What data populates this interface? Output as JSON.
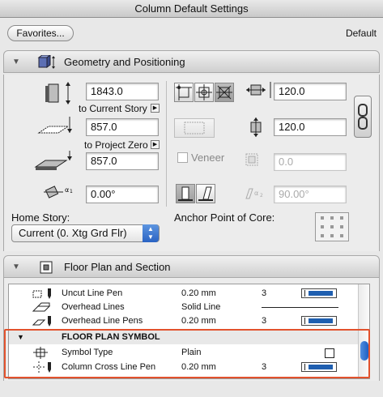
{
  "window": {
    "title": "Column Default Settings"
  },
  "toolbar": {
    "favorites_label": "Favorites...",
    "default_label": "Default"
  },
  "geometry": {
    "title": "Geometry and Positioning",
    "height_value": "1843.0",
    "to_current_story_label": "to Current Story",
    "offset_value": "857.0",
    "to_project_zero_label": "to Project Zero",
    "bottom_value": "857.0",
    "angle_value": "0.00°",
    "width_value": "120.0",
    "depth_value": "120.0",
    "veneer_label": "Veneer",
    "veneer_value": "0.0",
    "slant_value": "90.00°",
    "home_story_label": "Home Story:",
    "home_story_value": "Current (0. Xtg Grd Flr)",
    "anchor_label": "Anchor Point of Core:"
  },
  "floorplan": {
    "title": "Floor Plan and Section",
    "rows": [
      {
        "name": "Uncut Line Pen",
        "value": "0.20 mm",
        "num": "3",
        "widget": "pen"
      },
      {
        "name": "Overhead Lines",
        "value": "Solid Line",
        "num": "",
        "widget": "line"
      },
      {
        "name": "Overhead Line Pens",
        "value": "0.20 mm",
        "num": "3",
        "widget": "pen"
      },
      {
        "name": "FLOOR PLAN SYMBOL",
        "value": "",
        "num": "",
        "widget": "group"
      },
      {
        "name": "Symbol Type",
        "value": "Plain",
        "num": "",
        "widget": "box"
      },
      {
        "name": "Column Cross Line Pen",
        "value": "0.20 mm",
        "num": "3",
        "widget": "pen"
      }
    ]
  },
  "icons": {
    "geometry_section": "column-3d-icon",
    "floorplan_section": "floor-plan-icon",
    "chain_lock": "chain-link-icon"
  }
}
